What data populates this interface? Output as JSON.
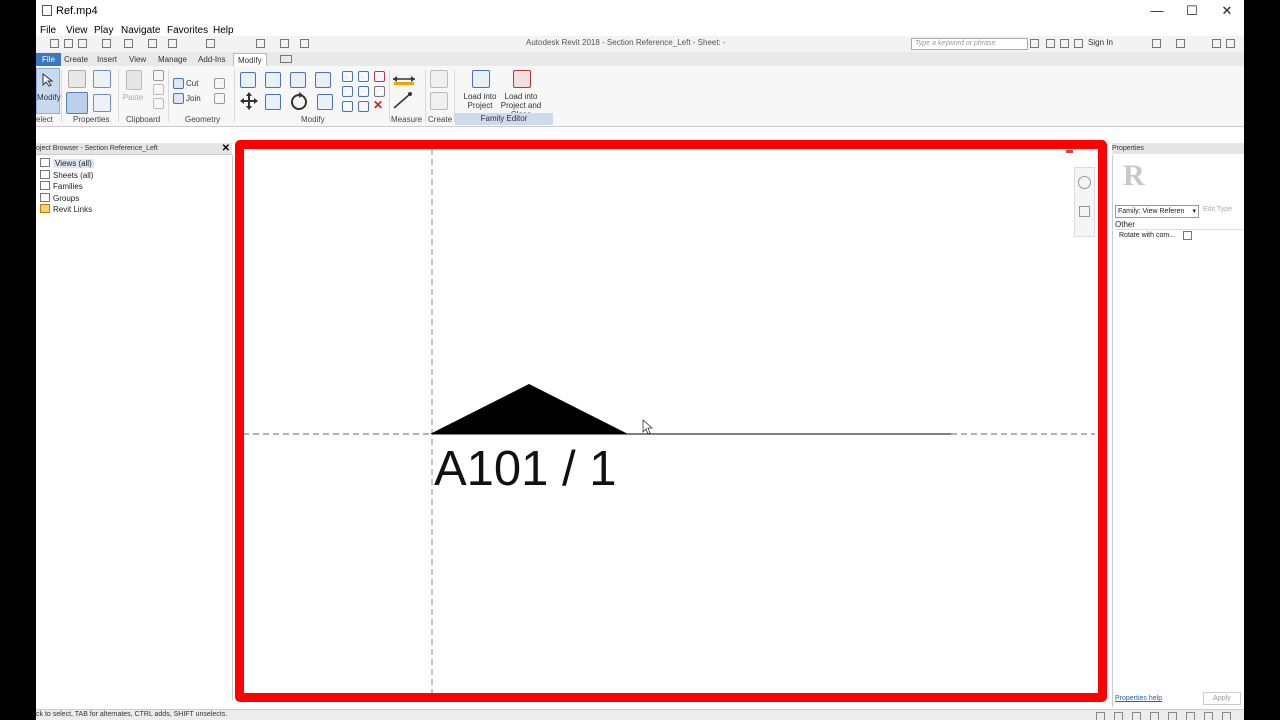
{
  "player": {
    "title": "Ref.mp4",
    "menu": [
      "File",
      "View",
      "Play",
      "Navigate",
      "Favorites",
      "Help"
    ],
    "minimize": "—",
    "maximize": "☐",
    "close": "✕"
  },
  "revit": {
    "title": "Autodesk Revit 2018 -   Section Reference_Left - Sheet: -",
    "search_placeholder": "Type a keyword or phrase",
    "sign_in": "Sign In",
    "tabs": [
      "File",
      "Create",
      "Insert",
      "View",
      "Manage",
      "Add-Ins",
      "Modify"
    ],
    "active_tab": "Modify",
    "ribbon": {
      "modify_label": "Modify",
      "select_label": "elect",
      "panels": [
        "Properties",
        "Clipboard",
        "Geometry",
        "Modify",
        "Measure",
        "Create"
      ],
      "paste": "Paste",
      "cut": "Cut",
      "join": "Join",
      "load_into_project_l1": "Load into",
      "load_into_project_l2": "Project",
      "load_close_l1": "Load into",
      "load_close_l2": "Project and Close",
      "family_editor": "Family Editor"
    }
  },
  "project_browser": {
    "title": "oject Browser - Section Reference_Left",
    "items": [
      "Views (all)",
      "Sheets (all)",
      "Families",
      "Groups",
      "Revit Links"
    ]
  },
  "canvas": {
    "tag_text": "A101 / 1",
    "frame_color": "#ff0000"
  },
  "properties": {
    "title": "Properties",
    "logo": "R",
    "family": "Family: View Referen",
    "edit_type": "Edit Type",
    "group": "Other",
    "param": "Rotate with com...",
    "help": "Properties help",
    "apply": "Apply"
  },
  "status": {
    "text": "ck to select, TAB for alternates, CTRL adds, SHIFT unselects."
  }
}
